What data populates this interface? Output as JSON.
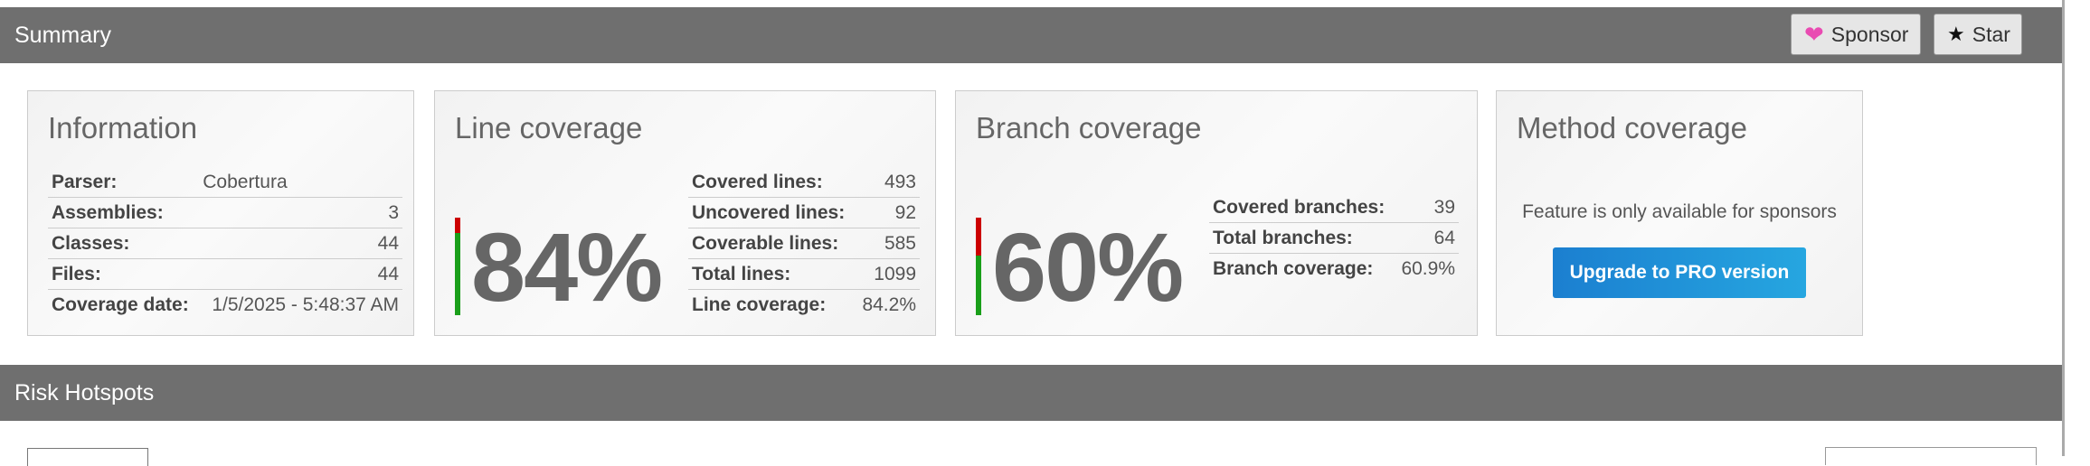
{
  "summary_bar": {
    "title": "Summary",
    "sponsor_label": "Sponsor",
    "star_label": "Star"
  },
  "information": {
    "title": "Information",
    "rows": [
      {
        "label": "Parser:",
        "value": "Cobertura"
      },
      {
        "label": "Assemblies:",
        "value": "3"
      },
      {
        "label": "Classes:",
        "value": "44"
      },
      {
        "label": "Files:",
        "value": "44"
      },
      {
        "label": "Coverage date:",
        "value": "1/5/2025 - 5:48:37 AM"
      }
    ]
  },
  "line_coverage": {
    "title": "Line coverage",
    "percent_text": "84%",
    "percent_value": 84.2,
    "rows": [
      {
        "label": "Covered lines:",
        "value": "493"
      },
      {
        "label": "Uncovered lines:",
        "value": "92"
      },
      {
        "label": "Coverable lines:",
        "value": "585"
      },
      {
        "label": "Total lines:",
        "value": "1099"
      },
      {
        "label": "Line coverage:",
        "value": "84.2%"
      }
    ]
  },
  "branch_coverage": {
    "title": "Branch coverage",
    "percent_text": "60%",
    "percent_value": 60.9,
    "rows": [
      {
        "label": "Covered branches:",
        "value": "39"
      },
      {
        "label": "Total branches:",
        "value": "64"
      },
      {
        "label": "Branch coverage:",
        "value": "60.9%"
      }
    ]
  },
  "method_coverage": {
    "title": "Method coverage",
    "note": "Feature is only available for sponsors",
    "upgrade_label": "Upgrade to PRO version"
  },
  "risk_bar": {
    "title": "Risk Hotspots"
  },
  "colors": {
    "bar_bg": "#6f6f6f",
    "covered": "#1a9f1a",
    "uncovered": "#cc0000",
    "pro_button": "#1e88d0",
    "heart": "#e94bb2"
  }
}
